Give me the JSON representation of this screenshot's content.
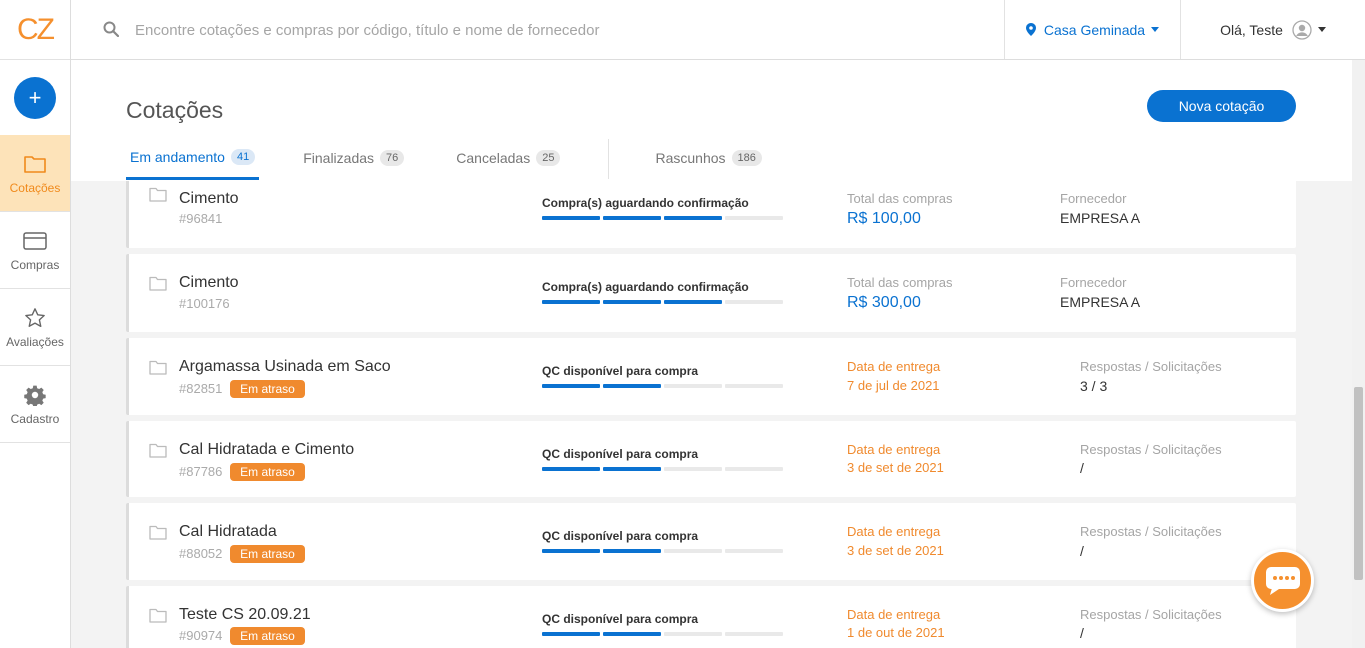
{
  "brand": {
    "logo": "CZ"
  },
  "sidebar": {
    "add_label": "+",
    "items": [
      {
        "label": "Cotações",
        "icon": "folder-icon",
        "active": true
      },
      {
        "label": "Compras",
        "icon": "card-icon",
        "active": false
      },
      {
        "label": "Avaliações",
        "icon": "star-icon",
        "active": false
      },
      {
        "label": "Cadastro",
        "icon": "gear-icon",
        "active": false
      }
    ]
  },
  "topbar": {
    "search_placeholder": "Encontre cotações e compras por código, título e nome de fornecedor",
    "location": "Casa Geminada",
    "greeting": "Olá, Teste"
  },
  "page": {
    "title": "Cotações",
    "new_button": "Nova cotação",
    "tabs": [
      {
        "label": "Em andamento",
        "count": "41",
        "active": true
      },
      {
        "label": "Finalizadas",
        "count": "76",
        "active": false
      },
      {
        "label": "Canceladas",
        "count": "25",
        "active": false
      },
      {
        "label": "Rascunhos",
        "count": "186",
        "active": false
      }
    ]
  },
  "cards": [
    {
      "title": "Cimento",
      "id": "#96841",
      "badge": "",
      "status": "Compra(s) aguardando confirmação",
      "progress": 3,
      "col1_label": "Total das compras",
      "col1_value": "R$ 100,00",
      "col2_label": "Fornecedor",
      "col2_value": "EMPRESA A"
    },
    {
      "title": "Cimento",
      "id": "#100176",
      "badge": "",
      "status": "Compra(s) aguardando confirmação",
      "progress": 3,
      "col1_label": "Total das compras",
      "col1_value": "R$ 300,00",
      "col2_label": "Fornecedor",
      "col2_value": "EMPRESA A"
    },
    {
      "title": "Argamassa Usinada em Saco",
      "id": "#82851",
      "badge": "Em atraso",
      "status": "QC disponível para compra",
      "progress": 2,
      "col1_label": "Data de entrega",
      "col1_value": "7 de jul de 2021",
      "col2_label": "Respostas / Solicitações",
      "col2_value": "3 / 3"
    },
    {
      "title": "Cal Hidratada e Cimento",
      "id": "#87786",
      "badge": "Em atraso",
      "status": "QC disponível para compra",
      "progress": 2,
      "col1_label": "Data de entrega",
      "col1_value": "3 de set de 2021",
      "col2_label": "Respostas / Solicitações",
      "col2_value": "/"
    },
    {
      "title": "Cal Hidratada",
      "id": "#88052",
      "badge": "Em atraso",
      "status": "QC disponível para compra",
      "progress": 2,
      "col1_label": "Data de entrega",
      "col1_value": "3 de set de 2021",
      "col2_label": "Respostas / Solicitações",
      "col2_value": "/"
    },
    {
      "title": "Teste CS 20.09.21",
      "id": "#90974",
      "badge": "Em atraso",
      "status": "QC disponível para compra",
      "progress": 2,
      "col1_label": "Data de entrega",
      "col1_value": "1 de out de 2021",
      "col2_label": "Respostas / Solicitações",
      "col2_value": "/"
    }
  ],
  "colors": {
    "primary": "#0a72d1",
    "accent": "#f08a2e",
    "active_nav_bg": "#fde3b9"
  }
}
